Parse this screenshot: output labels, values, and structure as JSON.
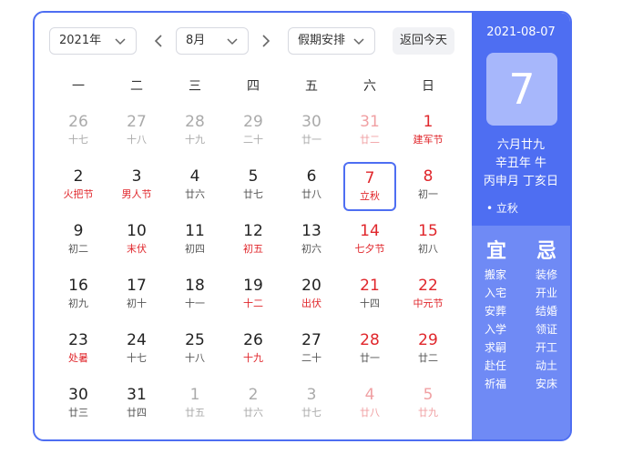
{
  "header": {
    "year": "2021年",
    "month": "8月",
    "holiday": "假期安排",
    "today": "返回今天"
  },
  "weekdays": [
    "一",
    "二",
    "三",
    "四",
    "五",
    "六",
    "日"
  ],
  "weeks": [
    [
      {
        "d": "26",
        "s": "十七",
        "t": "o"
      },
      {
        "d": "27",
        "s": "十八",
        "t": "o"
      },
      {
        "d": "28",
        "s": "十九",
        "t": "o"
      },
      {
        "d": "29",
        "s": "二十",
        "t": "o"
      },
      {
        "d": "30",
        "s": "廿一",
        "t": "o"
      },
      {
        "d": "31",
        "s": "廿二",
        "t": "ow"
      },
      {
        "d": "1",
        "s": "建军节",
        "t": "wf"
      }
    ],
    [
      {
        "d": "2",
        "s": "火把节",
        "t": "f"
      },
      {
        "d": "3",
        "s": "男人节",
        "t": "f"
      },
      {
        "d": "4",
        "s": "廿六",
        "t": "n"
      },
      {
        "d": "5",
        "s": "廿七",
        "t": "n"
      },
      {
        "d": "6",
        "s": "廿八",
        "t": "n"
      },
      {
        "d": "7",
        "s": "立秋",
        "t": "sel"
      },
      {
        "d": "8",
        "s": "初一",
        "t": "w"
      }
    ],
    [
      {
        "d": "9",
        "s": "初二",
        "t": "n"
      },
      {
        "d": "10",
        "s": "末伏",
        "t": "f"
      },
      {
        "d": "11",
        "s": "初四",
        "t": "n"
      },
      {
        "d": "12",
        "s": "初五",
        "t": "f"
      },
      {
        "d": "13",
        "s": "初六",
        "t": "n"
      },
      {
        "d": "14",
        "s": "七夕节",
        "t": "wf"
      },
      {
        "d": "15",
        "s": "初八",
        "t": "w"
      }
    ],
    [
      {
        "d": "16",
        "s": "初九",
        "t": "n"
      },
      {
        "d": "17",
        "s": "初十",
        "t": "n"
      },
      {
        "d": "18",
        "s": "十一",
        "t": "n"
      },
      {
        "d": "19",
        "s": "十二",
        "t": "f"
      },
      {
        "d": "20",
        "s": "出伏",
        "t": "f"
      },
      {
        "d": "21",
        "s": "十四",
        "t": "w"
      },
      {
        "d": "22",
        "s": "中元节",
        "t": "wf"
      }
    ],
    [
      {
        "d": "23",
        "s": "处暑",
        "t": "f"
      },
      {
        "d": "24",
        "s": "十七",
        "t": "n"
      },
      {
        "d": "25",
        "s": "十八",
        "t": "n"
      },
      {
        "d": "26",
        "s": "十九",
        "t": "f"
      },
      {
        "d": "27",
        "s": "二十",
        "t": "n"
      },
      {
        "d": "28",
        "s": "廿一",
        "t": "w"
      },
      {
        "d": "29",
        "s": "廿二",
        "t": "w"
      }
    ],
    [
      {
        "d": "30",
        "s": "廿三",
        "t": "n"
      },
      {
        "d": "31",
        "s": "廿四",
        "t": "n"
      },
      {
        "d": "1",
        "s": "廿五",
        "t": "o"
      },
      {
        "d": "2",
        "s": "廿六",
        "t": "o"
      },
      {
        "d": "3",
        "s": "廿七",
        "t": "o"
      },
      {
        "d": "4",
        "s": "廿八",
        "t": "ow"
      },
      {
        "d": "5",
        "s": "廿九",
        "t": "ow"
      }
    ]
  ],
  "side": {
    "date": "2021-08-07",
    "day": "7",
    "lunar1": "六月廿九",
    "lunar2": "辛丑年 牛",
    "lunar3": "丙申月 丁亥日",
    "term": "• 立秋",
    "yi_title": "宜",
    "ji_title": "忌",
    "yi": [
      "搬家",
      "入宅",
      "安葬",
      "入学",
      "求嗣",
      "赴任",
      "祈福"
    ],
    "ji": [
      "装修",
      "开业",
      "结婚",
      "领证",
      "开工",
      "动土",
      "安床"
    ]
  },
  "colors": {
    "accent": "#4e6ef2",
    "red": "#e0262b",
    "muted": "#aaaaaa",
    "muted_red": "#f0a0a3"
  }
}
